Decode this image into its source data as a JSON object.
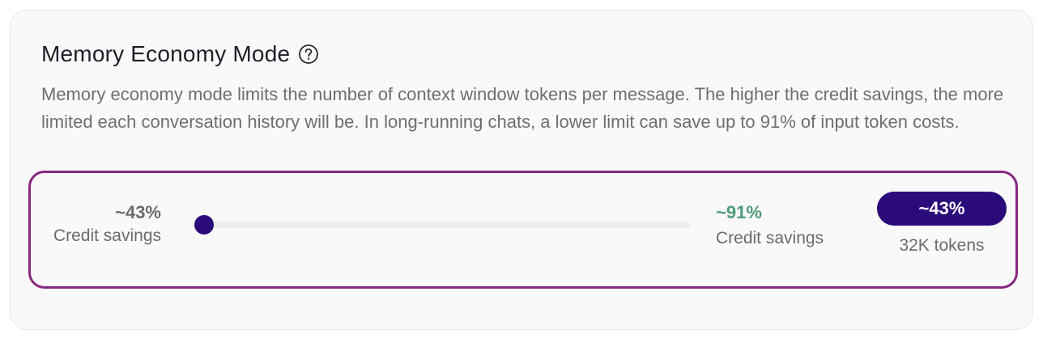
{
  "section": {
    "title": "Memory Economy Mode",
    "help_icon": "question-circle-icon",
    "description": "Memory economy mode limits the number of context window tokens per message. The higher the credit savings, the more limited each conversation history will be. In long-running chats, a lower limit can save up to 91% of input token costs."
  },
  "slider": {
    "min_label_value": "~43%",
    "min_label_caption": "Credit savings",
    "max_label_value": "~91%",
    "max_label_caption": "Credit savings",
    "current_value": "~43%",
    "current_tokens": "32K tokens",
    "position_fraction": 0.0
  },
  "colors": {
    "accent": "#2b0b7a",
    "highlight_border": "#86287f",
    "max_value": "#4f9a79",
    "muted_text": "#6e6e73"
  }
}
